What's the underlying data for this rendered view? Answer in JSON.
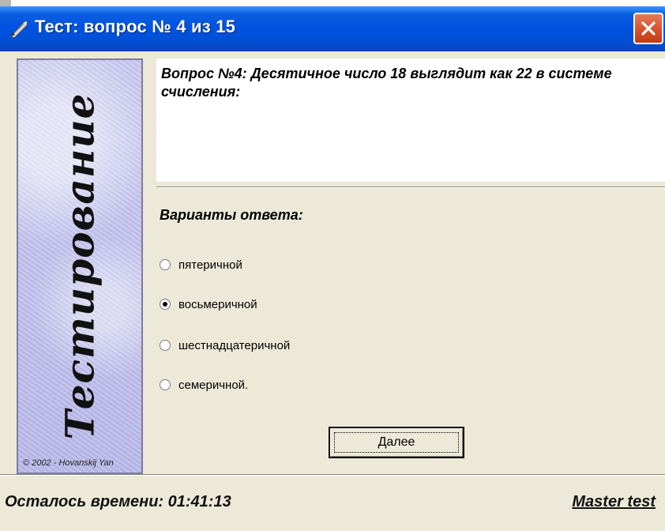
{
  "window": {
    "title": "Тест: вопрос № 4 из 15",
    "side_title": "Тестирование",
    "copyright": "© 2002 - Hovanskij Yan"
  },
  "question": {
    "text": "Вопрос №4: Десятичное число 18 выглядит как 22 в системе счисления:"
  },
  "answers": {
    "label": "Варианты ответа:",
    "options": [
      {
        "label": "пятеричной",
        "checked": false
      },
      {
        "label": "восьмеричной",
        "checked": true
      },
      {
        "label": "шестнадцатеричной",
        "checked": false
      },
      {
        "label": "семеричной.",
        "checked": false
      }
    ]
  },
  "buttons": {
    "next_label": "Далее"
  },
  "status": {
    "time_remaining": "Осталось времени: 01:41:13",
    "brand_link": "Master test"
  },
  "colors": {
    "titlebar": "#0053e1",
    "window_bg": "#ece9d8",
    "side_panel": "#b6b6e6",
    "close_button": "#d6522c"
  },
  "icons": {
    "app": "quill-pen-icon",
    "close": "close-icon"
  }
}
